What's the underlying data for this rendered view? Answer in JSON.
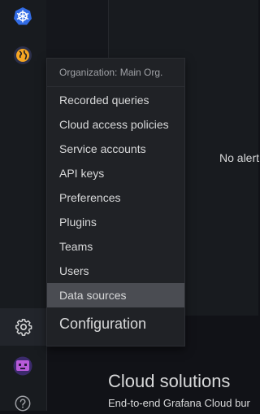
{
  "sidebar": {
    "icons": [
      {
        "name": "kubernetes-icon",
        "color": "#326ce5"
      },
      {
        "name": "globe-icon",
        "color": "#f5a623"
      },
      {
        "name": "gear-icon",
        "color": "#9fa1a6"
      },
      {
        "name": "avatar-icon",
        "color": "#b85bd9"
      },
      {
        "name": "help-icon",
        "color": "#9fa1a6"
      }
    ]
  },
  "background": {
    "no_alerts_text": "No alert",
    "cloud_title": "Cloud solutions",
    "cloud_subtitle": "End-to-end Grafana Cloud bur"
  },
  "menu": {
    "header": "Organization: Main Org.",
    "items": [
      {
        "label": "Recorded queries"
      },
      {
        "label": "Cloud access policies"
      },
      {
        "label": "Service accounts"
      },
      {
        "label": "API keys"
      },
      {
        "label": "Preferences"
      },
      {
        "label": "Plugins"
      },
      {
        "label": "Teams"
      },
      {
        "label": "Users"
      },
      {
        "label": "Data sources",
        "highlighted": true
      }
    ],
    "footer": "Configuration"
  },
  "colors": {
    "accent_highlight": "#4a4c52",
    "menu_bg": "#202226",
    "text": "#d8d9da"
  }
}
